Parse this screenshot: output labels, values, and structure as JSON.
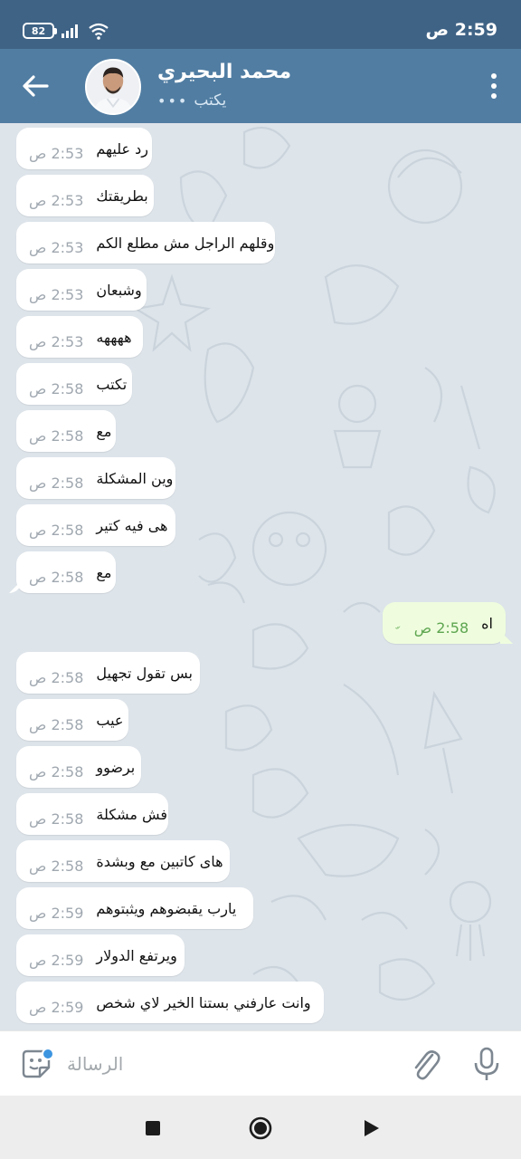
{
  "status_bar": {
    "battery": "82",
    "time": "2:59 ص"
  },
  "header": {
    "contact_name": "محمد البحيري",
    "status": "يكتب",
    "status_dots": "•••"
  },
  "messages": [
    {
      "text": "رد عليهم",
      "time": "2:53 ص",
      "direction": "in"
    },
    {
      "text": "بطريقتك",
      "time": "2:53 ص",
      "direction": "in"
    },
    {
      "text": "وقلهم الراجل مش مطلع الكم",
      "time": "2:53 ص",
      "direction": "in"
    },
    {
      "text": "وشبعان",
      "time": "2:53 ص",
      "direction": "in"
    },
    {
      "text": "ههههه",
      "time": "2:53 ص",
      "direction": "in"
    },
    {
      "text": "تكتب",
      "time": "2:58 ص",
      "direction": "in"
    },
    {
      "text": "مع",
      "time": "2:58 ص",
      "direction": "in"
    },
    {
      "text": "وين المشكلة",
      "time": "2:58 ص",
      "direction": "in"
    },
    {
      "text": "هى فيه كتير",
      "time": "2:58 ص",
      "direction": "in"
    },
    {
      "text": "مع",
      "time": "2:58 ص",
      "direction": "in"
    },
    {
      "text": "اه",
      "time": "2:58 ص",
      "direction": "out"
    },
    {
      "text": "بس تقول تجهيل",
      "time": "2:58 ص",
      "direction": "in"
    },
    {
      "text": "عيب",
      "time": "2:58 ص",
      "direction": "in"
    },
    {
      "text": "برضوو",
      "time": "2:58 ص",
      "direction": "in"
    },
    {
      "text": "فش مشكلة",
      "time": "2:58 ص",
      "direction": "in"
    },
    {
      "text": "هاى كاتبين مع وبشدة",
      "time": "2:58 ص",
      "direction": "in"
    },
    {
      "text": "يارب يقبضوهم ويثبتوهم",
      "time": "2:59 ص",
      "direction": "in"
    },
    {
      "text": "ويرتفع الدولار",
      "time": "2:59 ص",
      "direction": "in"
    },
    {
      "text": "وانت عارفني بستنا الخير لاي شخص",
      "time": "2:59 ص",
      "direction": "in"
    }
  ],
  "input": {
    "placeholder": "الرسالة",
    "value": ""
  },
  "colors": {
    "header": "#517da2",
    "status_bar": "#3f6385",
    "chat_background": "#dde4ea",
    "incoming_bubble": "#ffffff",
    "outgoing_bubble": "#effdde",
    "read_checks": "#5da54f"
  },
  "icons": {
    "back": "arrow-left-icon",
    "menu": "more-vertical-icon",
    "emoji": "sticker-icon",
    "attach": "paperclip-icon",
    "mic": "microphone-icon",
    "read": "double-check-icon"
  }
}
